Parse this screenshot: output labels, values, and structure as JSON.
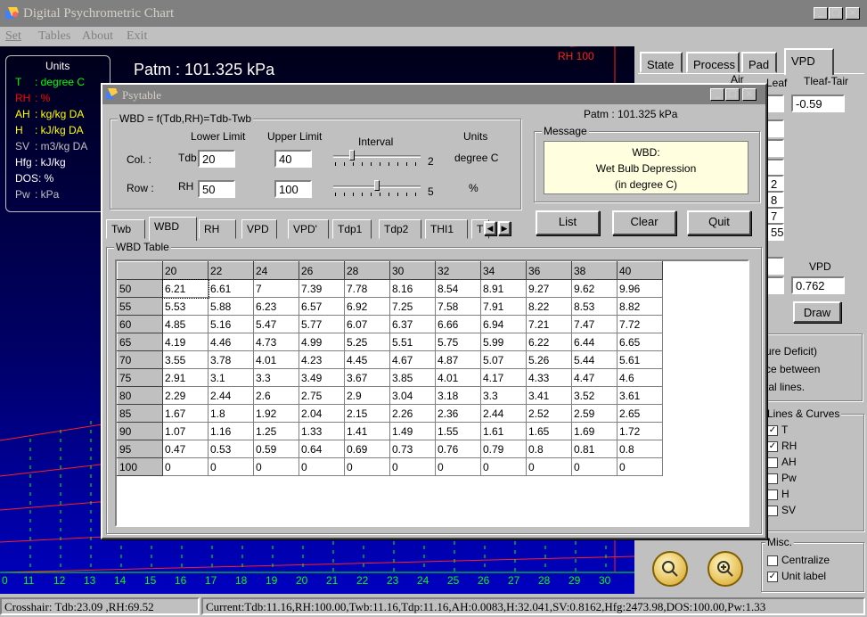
{
  "window": {
    "title": "Digital Psychrometric Chart",
    "menu": [
      "Set",
      "Tables",
      "About",
      "Exit"
    ]
  },
  "chart": {
    "patm_label": "Patm : 101.325 kPa",
    "rh_line_label": "RH 100",
    "x_ticks": [
      "11",
      "12",
      "13",
      "14",
      "15",
      "16",
      "17",
      "18",
      "19",
      "20",
      "21",
      "22",
      "23",
      "24",
      "25",
      "26",
      "27",
      "28",
      "29",
      "30"
    ],
    "x_tick_first": "0"
  },
  "units": {
    "header": "Units",
    "rows": [
      {
        "k": "T",
        "v": ": degree C",
        "color": "#00ff00"
      },
      {
        "k": "RH",
        "v": ": %",
        "color": "#ff0000"
      },
      {
        "k": "AH",
        "v": ": kg/kg DA",
        "color": "#ffff00"
      },
      {
        "k": "H",
        "v": ": kJ/kg DA",
        "color": "#ffff00"
      },
      {
        "k": "SV",
        "v": ": m3/kg DA",
        "color": "#c0c0c0"
      },
      {
        "k": "Hfg",
        "v": ": kJ/kg",
        "color": "#ffffff"
      },
      {
        "k": "DOS",
        "v": ": %",
        "color": "#ffffff"
      },
      {
        "k": "Pw",
        "v": ": kPa",
        "color": "#c0c0c0"
      }
    ]
  },
  "right_panel": {
    "tabs": [
      "State",
      "Process",
      "Pad",
      "VPD"
    ],
    "air_label": "Air",
    "leaf_label": "Leaf",
    "tleaf_tair_label": "Tleaf-Tair",
    "tleaf_tair_value": "-0.59",
    "partial_values": [
      "2",
      "8",
      "7",
      "55"
    ],
    "vpd_label": "VPD",
    "vpd_value": "0.762",
    "draw_button": "Draw",
    "desc_lines": [
      "ure Deficit)",
      "ce between",
      "tal lines."
    ],
    "lines_curves_title": "Lines & Curves",
    "lines_curves": [
      {
        "label": "T",
        "checked": true
      },
      {
        "label": "RH",
        "checked": true
      },
      {
        "label": "AH",
        "checked": false
      },
      {
        "label": "Pw",
        "checked": false
      },
      {
        "label": "H",
        "checked": false
      },
      {
        "label": "SV",
        "checked": false
      }
    ],
    "misc_title": "Misc.",
    "misc": [
      {
        "label": "Centralize",
        "checked": false
      },
      {
        "label": "Unit label",
        "checked": true
      }
    ]
  },
  "dialog": {
    "title": "Psytable",
    "formula": "WBD = f(Tdb,RH)=Tdb-Twb",
    "lower_limit_label": "Lower Limit",
    "upper_limit_label": "Upper Limit",
    "interval_label": "Interval",
    "units_label": "Units",
    "col_label": "Col. :",
    "col_var": "Tdb",
    "col_lower": "20",
    "col_upper": "40",
    "col_interval": "2",
    "col_interval_fraction": 0.2,
    "col_unit": "degree C",
    "row_label": "Row :",
    "row_var": "RH",
    "row_lower": "50",
    "row_upper": "100",
    "row_interval": "5",
    "row_interval_fraction": 0.5,
    "row_unit": "%",
    "patm": "Patm : 101.325 kPa",
    "message_title": "Message",
    "message_lines": [
      "WBD:",
      "Wet Bulb Depression",
      "(in degree C)"
    ],
    "buttons": {
      "list": "List",
      "clear": "Clear",
      "quit": "Quit"
    },
    "tabs": [
      "Twb",
      "WBD",
      "RH",
      "VPD",
      "VPD'",
      "Tdp1",
      "Tdp2",
      "THI1",
      "T"
    ],
    "active_tab": "WBD",
    "table_title": "WBD Table",
    "col_headers": [
      "20",
      "22",
      "24",
      "26",
      "28",
      "30",
      "32",
      "34",
      "36",
      "38",
      "40"
    ],
    "rows": [
      {
        "rh": "50",
        "cells": [
          "6.21",
          "6.61",
          "7",
          "7.39",
          "7.78",
          "8.16",
          "8.54",
          "8.91",
          "9.27",
          "9.62",
          "9.96"
        ]
      },
      {
        "rh": "55",
        "cells": [
          "5.53",
          "5.88",
          "6.23",
          "6.57",
          "6.92",
          "7.25",
          "7.58",
          "7.91",
          "8.22",
          "8.53",
          "8.82"
        ]
      },
      {
        "rh": "60",
        "cells": [
          "4.85",
          "5.16",
          "5.47",
          "5.77",
          "6.07",
          "6.37",
          "6.66",
          "6.94",
          "7.21",
          "7.47",
          "7.72"
        ]
      },
      {
        "rh": "65",
        "cells": [
          "4.19",
          "4.46",
          "4.73",
          "4.99",
          "5.25",
          "5.51",
          "5.75",
          "5.99",
          "6.22",
          "6.44",
          "6.65"
        ]
      },
      {
        "rh": "70",
        "cells": [
          "3.55",
          "3.78",
          "4.01",
          "4.23",
          "4.45",
          "4.67",
          "4.87",
          "5.07",
          "5.26",
          "5.44",
          "5.61"
        ]
      },
      {
        "rh": "75",
        "cells": [
          "2.91",
          "3.1",
          "3.3",
          "3.49",
          "3.67",
          "3.85",
          "4.01",
          "4.17",
          "4.33",
          "4.47",
          "4.6"
        ]
      },
      {
        "rh": "80",
        "cells": [
          "2.29",
          "2.44",
          "2.6",
          "2.75",
          "2.9",
          "3.04",
          "3.18",
          "3.3",
          "3.41",
          "3.52",
          "3.61"
        ]
      },
      {
        "rh": "85",
        "cells": [
          "1.67",
          "1.8",
          "1.92",
          "2.04",
          "2.15",
          "2.26",
          "2.36",
          "2.44",
          "2.52",
          "2.59",
          "2.65"
        ]
      },
      {
        "rh": "90",
        "cells": [
          "1.07",
          "1.16",
          "1.25",
          "1.33",
          "1.41",
          "1.49",
          "1.55",
          "1.61",
          "1.65",
          "1.69",
          "1.72"
        ]
      },
      {
        "rh": "95",
        "cells": [
          "0.47",
          "0.53",
          "0.59",
          "0.64",
          "0.69",
          "0.73",
          "0.76",
          "0.79",
          "0.8",
          "0.81",
          "0.8"
        ]
      },
      {
        "rh": "100",
        "cells": [
          "0",
          "0",
          "0",
          "0",
          "0",
          "0",
          "0",
          "0",
          "0",
          "0",
          "0"
        ]
      }
    ]
  },
  "status": {
    "crosshair": "Crosshair: Tdb:23.09 ,RH:69.52",
    "current": "Current:Tdb:11.16,RH:100.00,Twb:11.16,Tdp:11.16,AH:0.0083,H:32.041,SV:0.8162,Hfg:2473.98,DOS:100.00,Pw:1.33"
  }
}
